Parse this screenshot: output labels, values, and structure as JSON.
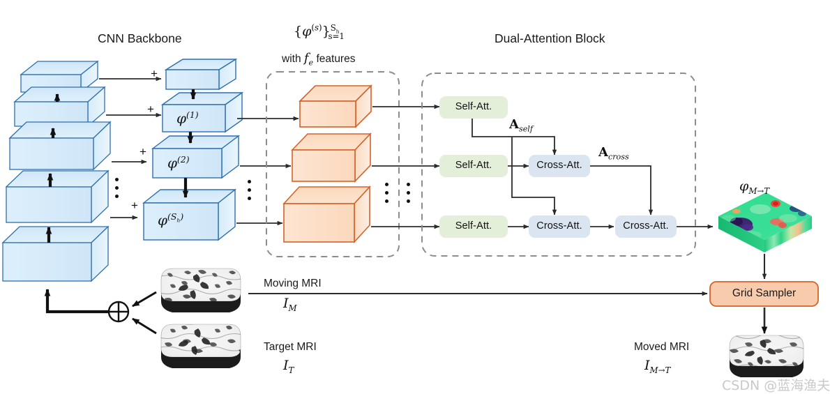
{
  "figure": {
    "type": "architecture-diagram",
    "background": "#ffffff"
  },
  "titles": {
    "cnn_backbone": "CNN Backbone",
    "feature_set_line1": "{ϕ(s)}Sh s=1",
    "feature_set_line2": "with fe features",
    "dual_attention": "Dual-Attention Block"
  },
  "encoder": {
    "name": "CNN Backbone encoder stack",
    "levels": 5,
    "skip_plus_label": "+"
  },
  "decoder": {
    "boxes": [
      {
        "label": ""
      },
      {
        "label": "ϕ(1)"
      },
      {
        "label": "ϕ(2)"
      },
      {
        "label": "ϕ(Sh)"
      }
    ],
    "vertical_dots": "⋮"
  },
  "features": {
    "count": 3,
    "vertical_dots": "⋮"
  },
  "attention": {
    "rows": [
      {
        "self": "Self-Att.",
        "cross": []
      },
      {
        "self": "Self-Att.",
        "cross": [
          "Cross-Att."
        ]
      },
      {
        "self": "Self-Att.",
        "cross": [
          "Cross-Att.",
          "Cross-Att."
        ]
      }
    ],
    "self_label": "Self-Att.",
    "cross_label": "Cross-Att.",
    "edge_labels": {
      "a_self": "Aself",
      "a_cross": "Across"
    },
    "vertical_dots": "⋮"
  },
  "outputs": {
    "deformation_field_label": "ϕM→T",
    "grid_sampler": "Grid Sampler"
  },
  "inputs": {
    "moving": {
      "title": "Moving MRI",
      "symbol": "IM"
    },
    "target": {
      "title": "Target MRI",
      "symbol": "IT"
    },
    "moved": {
      "title": "Moved MRI",
      "symbol": "IM→T"
    },
    "concat_symbol": "⊕"
  },
  "watermark": "CSDN @蓝海渔夫",
  "colors": {
    "box_blue_face": "#ddeefb",
    "box_blue_top": "#cde6f7",
    "box_blue_side": "#e9f4fc",
    "box_blue_border": "#2e6fad",
    "box_orange_face": "#fbdcc4",
    "box_orange_top": "#fadcc2",
    "box_orange_side": "#fdeadb",
    "box_orange_border": "#d4622a",
    "self_att_fill": "#e4efda",
    "cross_att_fill": "#dbe5f2",
    "grid_sampler_fill": "#f8cbad",
    "grid_sampler_border": "#d4622a",
    "dashed_border": "#8c8c8c",
    "arrow": "#2b2b2b",
    "watermark": "#c9c9c9"
  }
}
